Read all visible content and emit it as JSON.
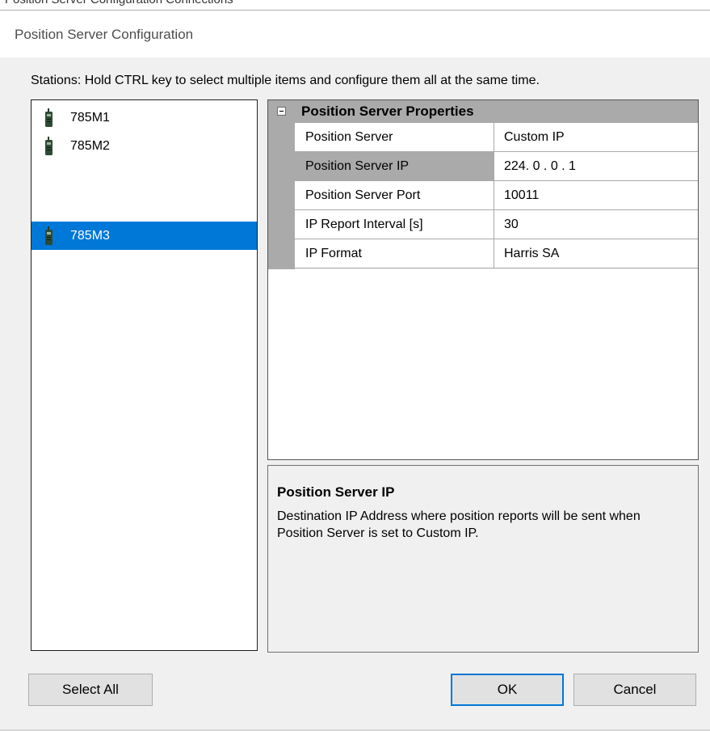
{
  "background_window": {
    "clipped_text": "Position Server Configuration Connections"
  },
  "window": {
    "title": "Position Server Configuration"
  },
  "stations": {
    "hint": "Stations:  Hold CTRL key to select multiple items and configure them all at the same time.",
    "icon": "radio-handset-icon",
    "items": [
      {
        "label": "785M1",
        "selected": false
      },
      {
        "label": "785M2",
        "selected": false
      },
      {
        "label": "785M3",
        "selected": true
      }
    ]
  },
  "properties": {
    "category": "Position Server Properties",
    "collapse_icon": "minus-box-icon",
    "rows": [
      {
        "name": "Position Server",
        "value": "Custom IP"
      },
      {
        "name": "Position Server IP",
        "value": "224. 0 . 0 . 1",
        "selected": true
      },
      {
        "name": "Position Server Port",
        "value": "10011"
      },
      {
        "name": "IP Report Interval [s]",
        "value": "30"
      },
      {
        "name": "IP Format",
        "value": "Harris SA"
      }
    ]
  },
  "help": {
    "title": "Position Server IP",
    "description": "Destination IP Address where position reports will be sent when Position Server is set to Custom IP."
  },
  "buttons": {
    "select_all": "Select All",
    "ok": "OK",
    "cancel": "Cancel"
  },
  "colors": {
    "selection": "#0078d7",
    "grid_gray": "#aaaaaa",
    "dialog_bg": "#f0f0f0"
  }
}
